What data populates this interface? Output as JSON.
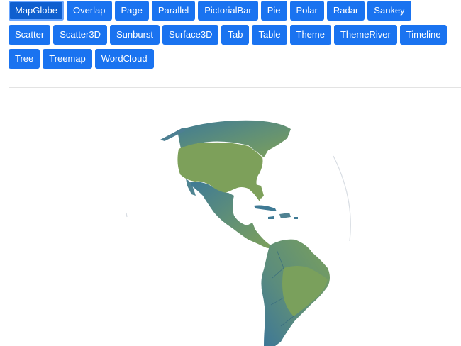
{
  "toolbar": {
    "buttons": [
      "MapGlobe",
      "Overlap",
      "Page",
      "Parallel",
      "PictorialBar",
      "Pie",
      "Polar",
      "Radar",
      "Sankey",
      "Scatter",
      "Scatter3D",
      "Sunburst",
      "Surface3D",
      "Tab",
      "Table",
      "Theme",
      "ThemeRiver",
      "Timeline",
      "Tree",
      "Treemap",
      "WordCloud"
    ],
    "active": "MapGlobe"
  },
  "colors": {
    "button": "#1a73f0",
    "button_active": "#0f5fcf",
    "land_light": "#7da05a",
    "land_dark": "#3f7a95"
  }
}
